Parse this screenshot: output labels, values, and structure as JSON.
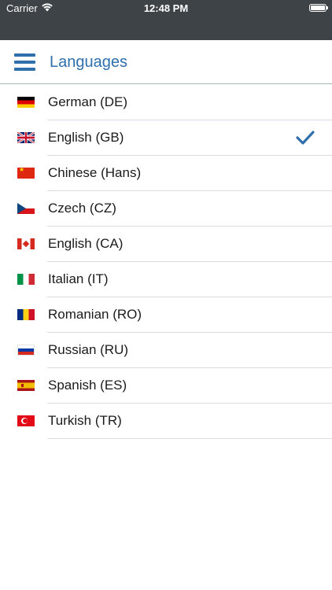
{
  "status_bar": {
    "carrier": "Carrier",
    "time": "12:48 PM"
  },
  "header": {
    "title": "Languages",
    "menu_icon": "hamburger-menu-icon"
  },
  "colors": {
    "accent": "#2f6fab",
    "status_bar_bg": "#3d4347",
    "divider": "#d9dcde"
  },
  "languages": [
    {
      "label": "German (DE)",
      "flag": "de",
      "selected": false
    },
    {
      "label": "English (GB)",
      "flag": "gb",
      "selected": true
    },
    {
      "label": "Chinese (Hans)",
      "flag": "cn",
      "selected": false
    },
    {
      "label": "Czech (CZ)",
      "flag": "cz",
      "selected": false
    },
    {
      "label": "English (CA)",
      "flag": "ca",
      "selected": false
    },
    {
      "label": "Italian (IT)",
      "flag": "it",
      "selected": false
    },
    {
      "label": "Romanian (RO)",
      "flag": "ro",
      "selected": false
    },
    {
      "label": "Russian (RU)",
      "flag": "ru",
      "selected": false
    },
    {
      "label": "Spanish (ES)",
      "flag": "es",
      "selected": false
    },
    {
      "label": "Turkish (TR)",
      "flag": "tr",
      "selected": false
    }
  ]
}
